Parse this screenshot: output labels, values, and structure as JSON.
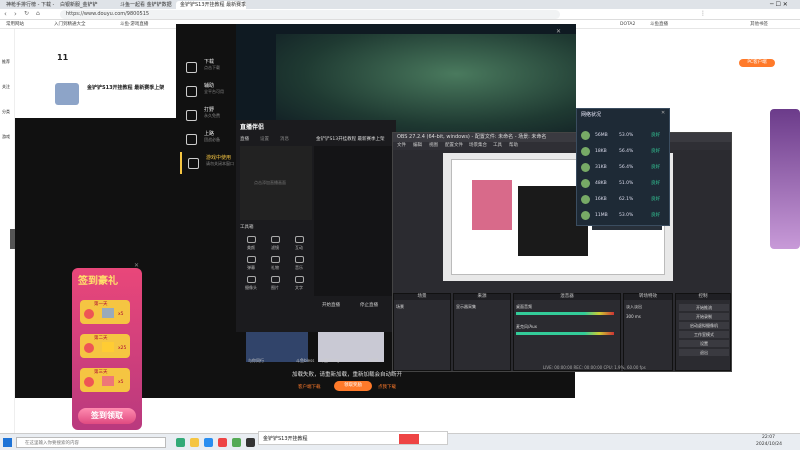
{
  "browser": {
    "tabs": [
      "神枪手排行榜 - 下载 - 斗鱼",
      "白银新服_金铲铲",
      "斗鱼一起看 金铲铲数据",
      "金铲铲S13开挂教程 最新赛季上架_斗鱼直播"
    ],
    "url": "https://www.douyu.com/9800515",
    "bookmarks": [
      "常用网站",
      "入门到精通大全",
      "斗鱼·游戏直播",
      "DOTA2",
      "斗鱼直播",
      "其他书签"
    ]
  },
  "left_rail": {
    "items": [
      "推荐",
      "关注",
      "分类",
      "游戏"
    ]
  },
  "stream_header": {
    "room_number": "11",
    "streamer_name": "金铲铲S13开挂教程 最新赛季上架",
    "badge": "PC客户端"
  },
  "game_overlay": {
    "menu": [
      {
        "title": "下载",
        "sub": "点击下载"
      },
      {
        "title": "辅助",
        "sub": "全平台可用"
      },
      {
        "title": "打野",
        "sub": "永久免费"
      },
      {
        "title": "上路",
        "sub": "团战必备"
      },
      {
        "title": "游戏中使用",
        "sub": "请勿关闭本窗口"
      }
    ]
  },
  "obs_client": {
    "title": "直播伴侣",
    "header_tabs": [
      "直播",
      "设置",
      "消息"
    ],
    "stream_title": "金铲铲S13开挂教程 最新赛季上架",
    "preview_hint": "点击添加直播画面",
    "tools_label": "工具箱",
    "tools": [
      "美颜",
      "滤镜",
      "互动",
      "弹幕",
      "礼物",
      "音乐",
      "摄像头",
      "图片",
      "文字"
    ],
    "bottom_buttons": [
      "开始直播",
      "停止直播"
    ]
  },
  "obs": {
    "title": "OBS 27.2.4 (64-bit, windows) - 配置文件: 未命名 - 场景: 未命名",
    "menus": [
      "文件",
      "编辑",
      "视图",
      "配置文件",
      "场景集合",
      "工具",
      "帮助"
    ],
    "panels": [
      "场景",
      "来源",
      "混音器",
      "转场特效",
      "控制"
    ],
    "scene_item": "场景",
    "source_item": "显示器采集",
    "mixer": [
      "桌面音频",
      "麦克风/Aux"
    ],
    "controls": [
      "开始推流",
      "开始录制",
      "启动虚拟摄像机",
      "工作室模式",
      "设置",
      "退出"
    ],
    "transition": "淡入淡出",
    "duration": "300 ms",
    "status": "LIVE: 00:00:00  REC: 00:00:00  CPU: 1.9%, 60.00 fps"
  },
  "network_panel": {
    "title": "网络状况",
    "rows": [
      {
        "value": "56MB",
        "pct": "53.0%",
        "state": "良好"
      },
      {
        "value": "18KB",
        "pct": "56.4%",
        "state": "良好"
      },
      {
        "value": "31KB",
        "pct": "56.4%",
        "state": "良好"
      },
      {
        "value": "48KB",
        "pct": "51.0%",
        "state": "良好"
      },
      {
        "value": "16KB",
        "pct": "62.1%",
        "state": "良好"
      },
      {
        "value": "11MB",
        "pct": "53.0%",
        "state": "良好"
      }
    ]
  },
  "dialog": {
    "message": "加载失败，请重新加载，重新加载会自动断开",
    "buttons": [
      "客户端下载",
      "领取奖励",
      "点我下载"
    ]
  },
  "thumbs": [
    "与你同行",
    "斗鱼bless",
    "斗鱼Carey",
    "3400"
  ],
  "sign_in": {
    "title": "签到豪礼",
    "days": [
      "第一天",
      "第二天",
      "第三天"
    ],
    "amounts": [
      "x5",
      "x25",
      "x5"
    ],
    "button": "签到领取"
  },
  "taskbar": {
    "search_placeholder": "在这里输入你要搜索的内容",
    "time": "22:07",
    "date": "2024/10/24",
    "popup_text": "金铲铲S13开挂教程"
  },
  "colors": {
    "orange": "#ff7a2a",
    "green": "#17b36a",
    "obs_bg": "#2b2b30",
    "sign_red": "#d83a5a"
  }
}
